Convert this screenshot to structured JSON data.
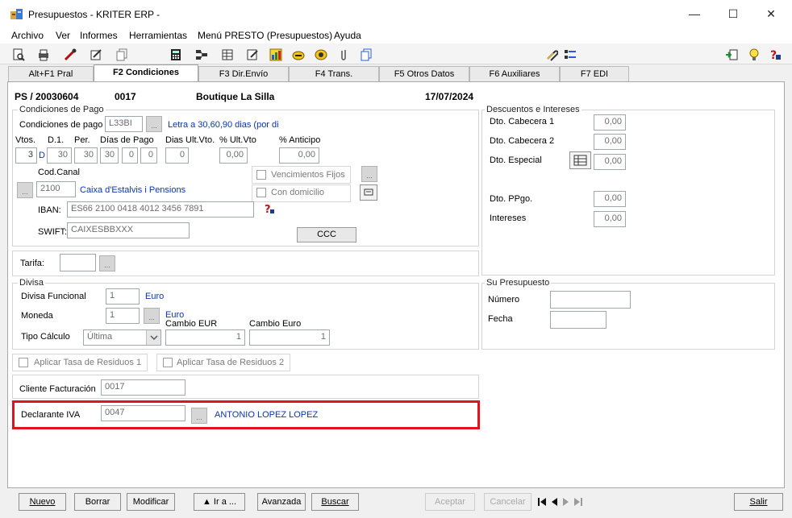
{
  "window": {
    "title": "Presupuestos - KRITER ERP -",
    "minimize": "—",
    "maximize": "☐",
    "close": "✕"
  },
  "menu": [
    "Archivo",
    "Ver",
    "Informes",
    "Herramientas",
    "Menú PRESTO (Presupuestos)",
    "Ayuda"
  ],
  "toolbar_icons": [
    "preview-icon",
    "print-icon",
    "tools-icon",
    "edit-icon",
    "copy-icon",
    "calculator-icon",
    "network-icon",
    "table-icon",
    "note-icon",
    "chart-icon",
    "pen-icon",
    "chat-icon",
    "clip-icon",
    "document-icon",
    "paperclip-icon",
    "grid-icon",
    "export-icon",
    "bulb-icon",
    "help-icon"
  ],
  "tabs": [
    {
      "label": "Alt+F1 Pral",
      "active": false
    },
    {
      "label": "F2 Condiciones",
      "active": true
    },
    {
      "label": "F3 Dir.Envío",
      "active": false
    },
    {
      "label": "F4 Trans.",
      "active": false
    },
    {
      "label": "F5 Otros Datos",
      "active": false
    },
    {
      "label": "F6 Auxiliares",
      "active": false
    },
    {
      "label": "F7 EDI",
      "active": false
    }
  ],
  "header": {
    "doc": "PS / 20030604",
    "code": "0017",
    "client": "Boutique La Silla",
    "date": "17/07/2024"
  },
  "pago": {
    "group": "Condiciones de Pago",
    "label": "Condiciones de pago",
    "code": "L33BI",
    "desc": "Letra a 30,60,90 dias (por di",
    "col_vtos": "Vtos.",
    "col_d1": "D.1.",
    "col_per": "Per.",
    "col_dias": "Días de Pago",
    "col_ult": "Dias Ult.Vto.",
    "col_pct_ult": "% Ult.Vto",
    "col_anticipo": "% Anticipo",
    "vtos": "3",
    "vtos_d": "D",
    "d1": "30",
    "per": "30",
    "dias1": "30",
    "dias2": "0",
    "dias3": "0",
    "ult": "0",
    "pct_ult": "0,00",
    "anticipo": "0,00",
    "vencimientos_fijos": "Vencimientos Fijos",
    "con_domicilio": "Con domicilio",
    "cod_canal": "Cod.Canal",
    "canal_code": "2100",
    "canal_name": "Caixa d'Estalvis i Pensions",
    "iban_label": "IBAN:",
    "iban": "ES66 2100 0418 4012 3456 7891",
    "swift_label": "SWIFT:",
    "swift": "CAIXESBBXXX",
    "ccc": "CCC"
  },
  "tarifa": {
    "label": "Tarifa:",
    "value": ""
  },
  "divisa": {
    "group": "Divisa",
    "funcional_label": "Divisa Funcional",
    "funcional_value": "1",
    "funcional_name": "Euro",
    "moneda_label": "Moneda",
    "moneda_value": "1",
    "moneda_name": "Euro",
    "cambio_eur_label": "Cambio EUR",
    "cambio_euro_label": "Cambio Euro",
    "tipo_label": "Tipo Cálculo",
    "tipo_value": "Última",
    "cambio_eur": "1",
    "cambio_euro": "1"
  },
  "residuos": {
    "tasa1": "Aplicar Tasa de Residuos 1",
    "tasa2": "Aplicar Tasa de Residuos 2"
  },
  "facturacion": {
    "label": "Cliente Facturación",
    "value": "0017"
  },
  "iva": {
    "label": "Declarante IVA",
    "value": "0047",
    "name": "ANTONIO LOPEZ LOPEZ"
  },
  "descuentos": {
    "group": "Descuentos e Intereses",
    "cabecera1_label": "Dto. Cabecera 1",
    "cabecera1": "0,00",
    "cabecera2_label": "Dto. Cabecera 2",
    "cabecera2": "0,00",
    "especial_label": "Dto. Especial",
    "especial": "0,00",
    "ppgo_label": "Dto. PPgo.",
    "ppgo": "0,00",
    "intereses_label": "Intereses",
    "intereses": "0,00"
  },
  "presupuesto": {
    "group": "Su Presupuesto",
    "numero_label": "Número",
    "numero": "",
    "fecha_label": "Fecha",
    "fecha": ""
  },
  "footer": {
    "nuevo": "Nuevo",
    "borrar": "Borrar",
    "modificar": "Modificar",
    "ira": "▲ Ir a ...",
    "avanzada": "Avanzada",
    "buscar": "Buscar",
    "aceptar": "Aceptar",
    "cancelar": "Cancelar",
    "salir": "Salir"
  },
  "colors": {
    "accent_link": "#0b33b8",
    "highlight": "#e0141f"
  }
}
